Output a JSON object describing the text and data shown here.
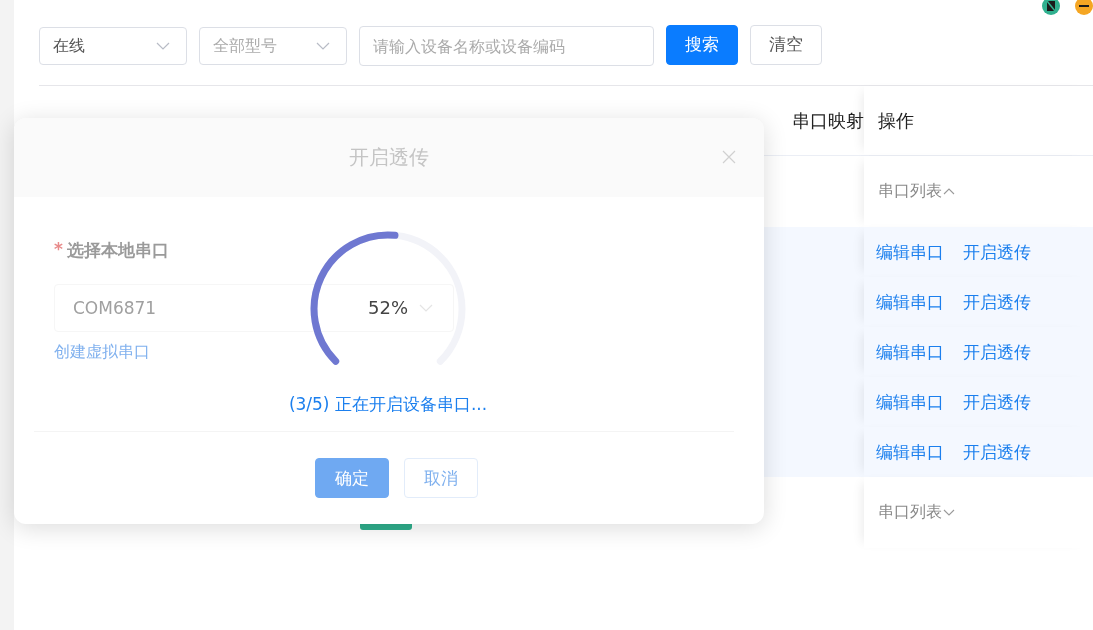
{
  "filters": {
    "status": {
      "value": "在线"
    },
    "model": {
      "placeholder": "全部型号"
    },
    "search": {
      "placeholder": "请输入设备名称或设备编码"
    }
  },
  "buttons": [
    {
      "label": "搜索",
      "kind": "primary"
    },
    {
      "label": "清空",
      "kind": "default"
    }
  ],
  "table": {
    "columns": [
      {
        "label": "串口映射"
      },
      {
        "label": "操作"
      }
    ],
    "groups": [
      {
        "label": "串口列表",
        "expanded": true,
        "rows": [
          {
            "actions": [
              "编辑串口",
              "开启透传"
            ]
          },
          {
            "actions": [
              "编辑串口",
              "开启透传"
            ]
          },
          {
            "actions": [
              "编辑串口",
              "开启透传"
            ]
          },
          {
            "actions": [
              "编辑串口",
              "开启透传"
            ]
          },
          {
            "actions": [
              "编辑串口",
              "开启透传"
            ]
          }
        ]
      },
      {
        "label": "串口列表",
        "expanded": false
      }
    ]
  },
  "dialog": {
    "title": "开启透传",
    "field_label": "选择本地串口",
    "required_mark": "*",
    "field_value": "COM6871",
    "link": "创建虚拟串口",
    "progress": {
      "level": 0.52,
      "reading": "52%",
      "status": "(3/5) 正在开启设备串口..."
    },
    "buttons": [
      {
        "label": "确定",
        "kind": "primary"
      },
      {
        "label": "取消",
        "kind": "default"
      }
    ]
  }
}
